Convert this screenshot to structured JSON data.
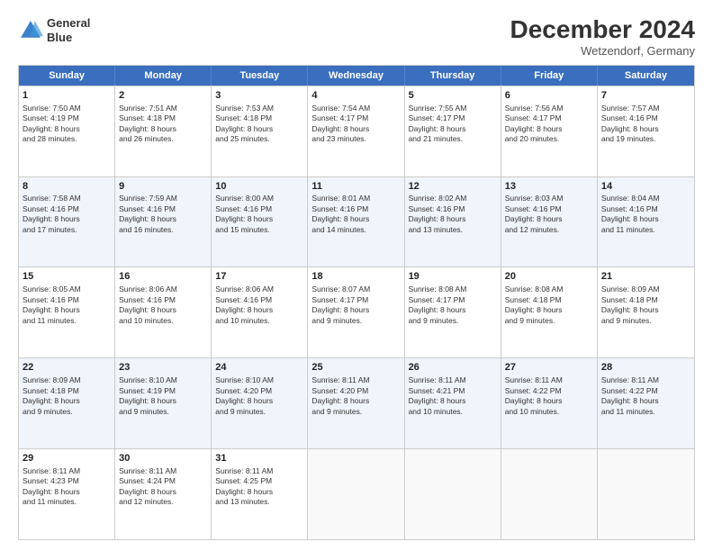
{
  "logo": {
    "line1": "General",
    "line2": "Blue"
  },
  "title": "December 2024",
  "location": "Wetzendorf, Germany",
  "days_header": [
    "Sunday",
    "Monday",
    "Tuesday",
    "Wednesday",
    "Thursday",
    "Friday",
    "Saturday"
  ],
  "weeks": [
    [
      {
        "day": "1",
        "lines": [
          "Sunrise: 7:50 AM",
          "Sunset: 4:19 PM",
          "Daylight: 8 hours",
          "and 28 minutes."
        ]
      },
      {
        "day": "2",
        "lines": [
          "Sunrise: 7:51 AM",
          "Sunset: 4:18 PM",
          "Daylight: 8 hours",
          "and 26 minutes."
        ]
      },
      {
        "day": "3",
        "lines": [
          "Sunrise: 7:53 AM",
          "Sunset: 4:18 PM",
          "Daylight: 8 hours",
          "and 25 minutes."
        ]
      },
      {
        "day": "4",
        "lines": [
          "Sunrise: 7:54 AM",
          "Sunset: 4:17 PM",
          "Daylight: 8 hours",
          "and 23 minutes."
        ]
      },
      {
        "day": "5",
        "lines": [
          "Sunrise: 7:55 AM",
          "Sunset: 4:17 PM",
          "Daylight: 8 hours",
          "and 21 minutes."
        ]
      },
      {
        "day": "6",
        "lines": [
          "Sunrise: 7:56 AM",
          "Sunset: 4:17 PM",
          "Daylight: 8 hours",
          "and 20 minutes."
        ]
      },
      {
        "day": "7",
        "lines": [
          "Sunrise: 7:57 AM",
          "Sunset: 4:16 PM",
          "Daylight: 8 hours",
          "and 19 minutes."
        ]
      }
    ],
    [
      {
        "day": "8",
        "lines": [
          "Sunrise: 7:58 AM",
          "Sunset: 4:16 PM",
          "Daylight: 8 hours",
          "and 17 minutes."
        ]
      },
      {
        "day": "9",
        "lines": [
          "Sunrise: 7:59 AM",
          "Sunset: 4:16 PM",
          "Daylight: 8 hours",
          "and 16 minutes."
        ]
      },
      {
        "day": "10",
        "lines": [
          "Sunrise: 8:00 AM",
          "Sunset: 4:16 PM",
          "Daylight: 8 hours",
          "and 15 minutes."
        ]
      },
      {
        "day": "11",
        "lines": [
          "Sunrise: 8:01 AM",
          "Sunset: 4:16 PM",
          "Daylight: 8 hours",
          "and 14 minutes."
        ]
      },
      {
        "day": "12",
        "lines": [
          "Sunrise: 8:02 AM",
          "Sunset: 4:16 PM",
          "Daylight: 8 hours",
          "and 13 minutes."
        ]
      },
      {
        "day": "13",
        "lines": [
          "Sunrise: 8:03 AM",
          "Sunset: 4:16 PM",
          "Daylight: 8 hours",
          "and 12 minutes."
        ]
      },
      {
        "day": "14",
        "lines": [
          "Sunrise: 8:04 AM",
          "Sunset: 4:16 PM",
          "Daylight: 8 hours",
          "and 11 minutes."
        ]
      }
    ],
    [
      {
        "day": "15",
        "lines": [
          "Sunrise: 8:05 AM",
          "Sunset: 4:16 PM",
          "Daylight: 8 hours",
          "and 11 minutes."
        ]
      },
      {
        "day": "16",
        "lines": [
          "Sunrise: 8:06 AM",
          "Sunset: 4:16 PM",
          "Daylight: 8 hours",
          "and 10 minutes."
        ]
      },
      {
        "day": "17",
        "lines": [
          "Sunrise: 8:06 AM",
          "Sunset: 4:16 PM",
          "Daylight: 8 hours",
          "and 10 minutes."
        ]
      },
      {
        "day": "18",
        "lines": [
          "Sunrise: 8:07 AM",
          "Sunset: 4:17 PM",
          "Daylight: 8 hours",
          "and 9 minutes."
        ]
      },
      {
        "day": "19",
        "lines": [
          "Sunrise: 8:08 AM",
          "Sunset: 4:17 PM",
          "Daylight: 8 hours",
          "and 9 minutes."
        ]
      },
      {
        "day": "20",
        "lines": [
          "Sunrise: 8:08 AM",
          "Sunset: 4:18 PM",
          "Daylight: 8 hours",
          "and 9 minutes."
        ]
      },
      {
        "day": "21",
        "lines": [
          "Sunrise: 8:09 AM",
          "Sunset: 4:18 PM",
          "Daylight: 8 hours",
          "and 9 minutes."
        ]
      }
    ],
    [
      {
        "day": "22",
        "lines": [
          "Sunrise: 8:09 AM",
          "Sunset: 4:18 PM",
          "Daylight: 8 hours",
          "and 9 minutes."
        ]
      },
      {
        "day": "23",
        "lines": [
          "Sunrise: 8:10 AM",
          "Sunset: 4:19 PM",
          "Daylight: 8 hours",
          "and 9 minutes."
        ]
      },
      {
        "day": "24",
        "lines": [
          "Sunrise: 8:10 AM",
          "Sunset: 4:20 PM",
          "Daylight: 8 hours",
          "and 9 minutes."
        ]
      },
      {
        "day": "25",
        "lines": [
          "Sunrise: 8:11 AM",
          "Sunset: 4:20 PM",
          "Daylight: 8 hours",
          "and 9 minutes."
        ]
      },
      {
        "day": "26",
        "lines": [
          "Sunrise: 8:11 AM",
          "Sunset: 4:21 PM",
          "Daylight: 8 hours",
          "and 10 minutes."
        ]
      },
      {
        "day": "27",
        "lines": [
          "Sunrise: 8:11 AM",
          "Sunset: 4:22 PM",
          "Daylight: 8 hours",
          "and 10 minutes."
        ]
      },
      {
        "day": "28",
        "lines": [
          "Sunrise: 8:11 AM",
          "Sunset: 4:22 PM",
          "Daylight: 8 hours",
          "and 11 minutes."
        ]
      }
    ],
    [
      {
        "day": "29",
        "lines": [
          "Sunrise: 8:11 AM",
          "Sunset: 4:23 PM",
          "Daylight: 8 hours",
          "and 11 minutes."
        ]
      },
      {
        "day": "30",
        "lines": [
          "Sunrise: 8:11 AM",
          "Sunset: 4:24 PM",
          "Daylight: 8 hours",
          "and 12 minutes."
        ]
      },
      {
        "day": "31",
        "lines": [
          "Sunrise: 8:11 AM",
          "Sunset: 4:25 PM",
          "Daylight: 8 hours",
          "and 13 minutes."
        ]
      },
      {
        "day": "",
        "lines": []
      },
      {
        "day": "",
        "lines": []
      },
      {
        "day": "",
        "lines": []
      },
      {
        "day": "",
        "lines": []
      }
    ]
  ]
}
